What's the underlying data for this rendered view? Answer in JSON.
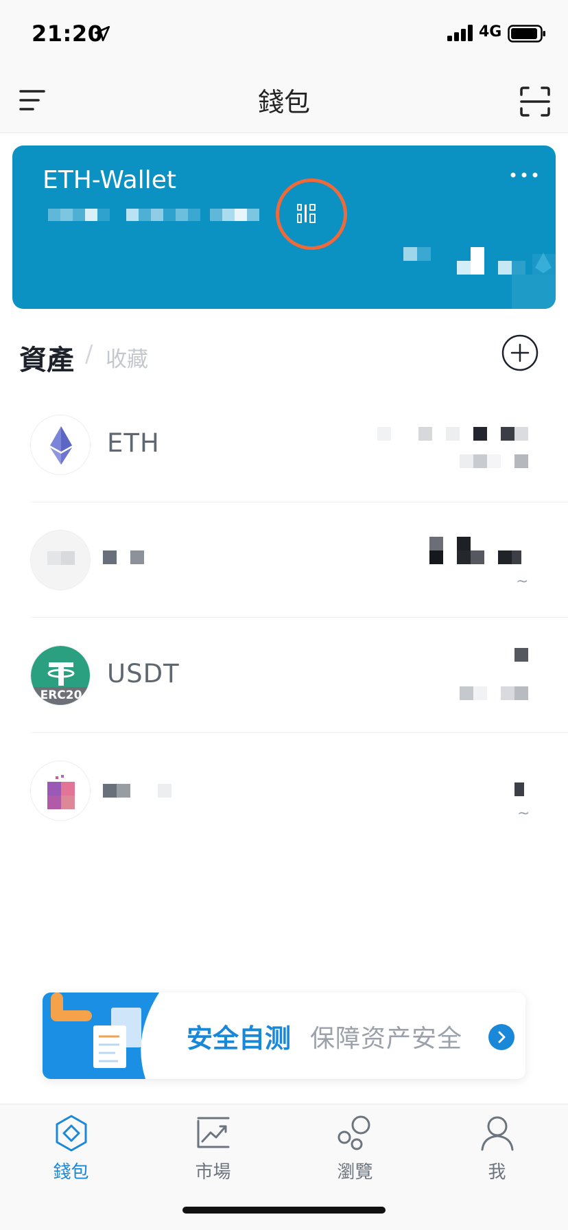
{
  "status_bar": {
    "time": "21:20",
    "network": "4G",
    "icons": [
      "location-arrow-icon",
      "signal-bars-icon",
      "battery-icon"
    ]
  },
  "nav": {
    "title": "錢包",
    "left_icon": "menu-icon",
    "right_icon": "scan-icon"
  },
  "wallet_card": {
    "name": "ETH-Wallet",
    "address": "",
    "balance": "",
    "colors": {
      "card": "#0b91c2",
      "highlight": "#ee6a3b"
    },
    "icons": [
      "more-icon",
      "qr-code-icon",
      "eth-watermark-icon"
    ]
  },
  "assets": {
    "tab_assets": "資產",
    "tab_separator": "/",
    "tab_favorites": "收藏",
    "add_icon": "plus-circle-icon",
    "items": [
      {
        "name": "ETH",
        "icon": "eth-icon"
      },
      {
        "name": "",
        "icon": "token-icon"
      },
      {
        "name": "USDT",
        "icon": "usdt-erc20-icon",
        "badge": "ERC20"
      },
      {
        "name": "",
        "icon": "token-icon"
      }
    ]
  },
  "banner": {
    "title": "安全自测",
    "subtitle": "保障资产安全",
    "icon": "chevron-right-icon"
  },
  "tab_bar": {
    "active": "錢包",
    "items": [
      {
        "label": "錢包",
        "icon": "wallet-icon"
      },
      {
        "label": "市場",
        "icon": "market-chart-icon"
      },
      {
        "label": "瀏覽",
        "icon": "browse-bubbles-icon"
      },
      {
        "label": "我",
        "icon": "profile-icon"
      }
    ],
    "accent": "#1a88d8"
  }
}
